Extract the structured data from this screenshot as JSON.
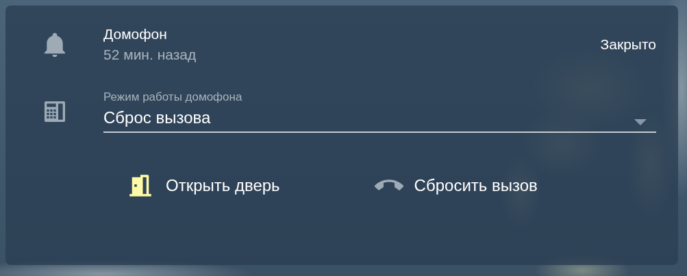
{
  "sensor": {
    "name": "Домофон",
    "time": "52 мин. назад",
    "state": "Закрыто"
  },
  "select": {
    "label": "Режим работы домофона",
    "value": "Сброс вызова"
  },
  "buttons": [
    {
      "kind": "door",
      "label": "Открыть дверь",
      "active": true
    },
    {
      "kind": "hangup",
      "label": "Сбросить вызов",
      "active": false
    }
  ]
}
